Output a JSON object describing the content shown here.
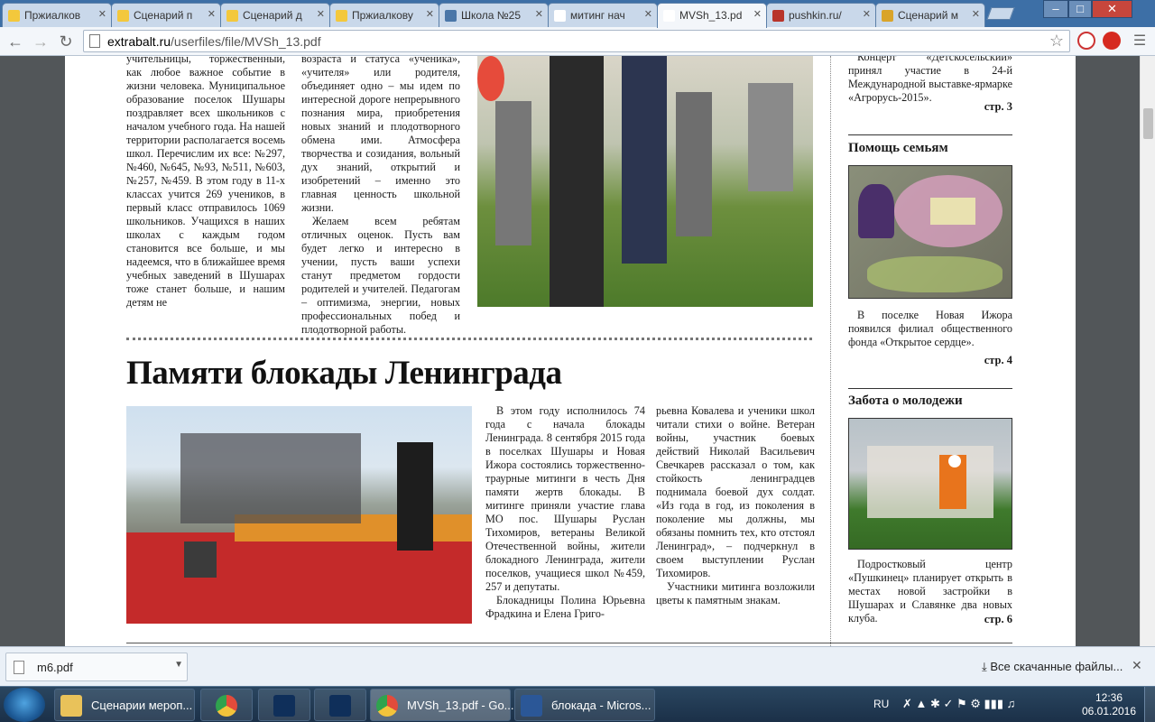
{
  "tabs": [
    {
      "label": "Пржиалков",
      "color": "#f3c83c"
    },
    {
      "label": "Сценарий п",
      "color": "#f3c83c"
    },
    {
      "label": "Сценарий д",
      "color": "#f3c83c"
    },
    {
      "label": "Пржиалкову",
      "color": "#f3c83c"
    },
    {
      "label": "Школа №25",
      "color": "#4a76a8"
    },
    {
      "label": "митинг нач",
      "color": "#ffffff"
    },
    {
      "label": "MVSh_13.pd",
      "color": "#ffffff",
      "active": true
    },
    {
      "label": "pushkin.ru/",
      "color": "#b8342a"
    },
    {
      "label": "Сценарий м",
      "color": "#d9a42a"
    }
  ],
  "url": {
    "host": "extrabalt.ru",
    "path": "/userfiles/file/MVSh_13.pdf"
  },
  "article": {
    "col1": "учительницы, торжественный, как любое важное событие в жизни человека. Муниципальное образование поселок Шушары поздравляет всех школьников с началом учебного года. На нашей территории располагается восемь школ. Перечислим их все: №297, №460, №645, №93, №511, №603, №257, №459. В этом году в 11-х классах учится 269 учеников, в первый класс отправилось 1069 школьников. Учащихся в наших школах с каждым годом становится все больше, и мы надеемся, что в ближайшее время учебных заведений в Шушарах тоже станет больше, и нашим детям не",
    "col2a": "возраста и статуса «ученика», «учителя» или родителя, объединяет одно – мы идем по интересной дороге непрерывного познания мира, приобретения новых знаний и плодотворного обмена ими. Атмосфера творчества и созидания, вольный дух знаний, открытий и изобретений – именно это главная ценность школьной жизни.",
    "col2b": "Желаем всем ребятам отличных оценок. Пусть вам будет легко и интересно в учении, пусть ваши успехи станут предметом гордости родителей и учителей. Педагогам – оптимизма, энергии, новых профессиональных побед и плодотворной работы."
  },
  "blockade": {
    "headline": "Памяти блокады Ленинграда",
    "col1a": "В этом году исполнилось 74 года с начала блокады Ленинграда. 8 сентября 2015 года в поселках Шушары и Новая Ижора состоялись торжественно-траурные митинги в честь Дня памяти жертв блокады. В митинге приняли участие глава МО пос. Шушары Руслан Тихомиров, ветераны Великой Отечественной войны, жители блокадного Ленинграда, жители поселков, учащиеся школ №459, 257 и депутаты.",
    "col1b": "Блокадницы Полина Юрьевна Фрадкина и Елена Григо-",
    "col2a": "рьевна Ковалева и ученики школ читали стихи о войне. Ветеран войны, участник боевых действий Николай Васильевич Свечкарев рассказал о том, как стойкость ленинградцев поднимала боевой дух солдат. «Из года в год, из поколения в поколение мы должны, мы обязаны помнить тех, кто отстоял Ленинград», – подчеркнул в своем выступлении Руслан Тихомиров.",
    "col2b": "Участники митинга возложили цветы к памятным знакам."
  },
  "sidebar": {
    "top_text": "Концерт «Детскосельский» принял участие в 24-й Международной выставке-ярмарке «Агрорусь-2015».",
    "top_ref": "стр. 3",
    "section1": {
      "title": "Помощь семьям",
      "text": "В поселке Новая Ижора появился филиал общественного фонда «Открытое сердце».",
      "ref": "стр. 4"
    },
    "section2": {
      "title": "Забота о молодежи",
      "text": "Подростковый центр «Пушкинец» планирует открыть в местах новой застройки в Шушарах и Славянке два новых клуба.",
      "ref": "стр. 6"
    }
  },
  "downloads": {
    "file": "m6.pdf",
    "show_all": "Все скачанные файлы..."
  },
  "taskbar": {
    "items": [
      {
        "label": "Сценарии мероп...",
        "icon": "folder-icon",
        "color": "#e9c25a"
      },
      {
        "label": "",
        "icon": "chrome-icon",
        "color": "#e24b3b"
      },
      {
        "label": "",
        "icon": "photoshop-icon",
        "color": "#0f2f5a"
      },
      {
        "label": "",
        "icon": "photoshop-icon",
        "color": "#0f2f5a"
      },
      {
        "label": "MVSh_13.pdf - Go...",
        "icon": "chrome-icon",
        "color": "#e24b3b",
        "active": true
      },
      {
        "label": "блокада - Micros...",
        "icon": "word-icon",
        "color": "#2b5797"
      }
    ],
    "lang": "RU",
    "time": "12:36",
    "date": "06.01.2016"
  }
}
